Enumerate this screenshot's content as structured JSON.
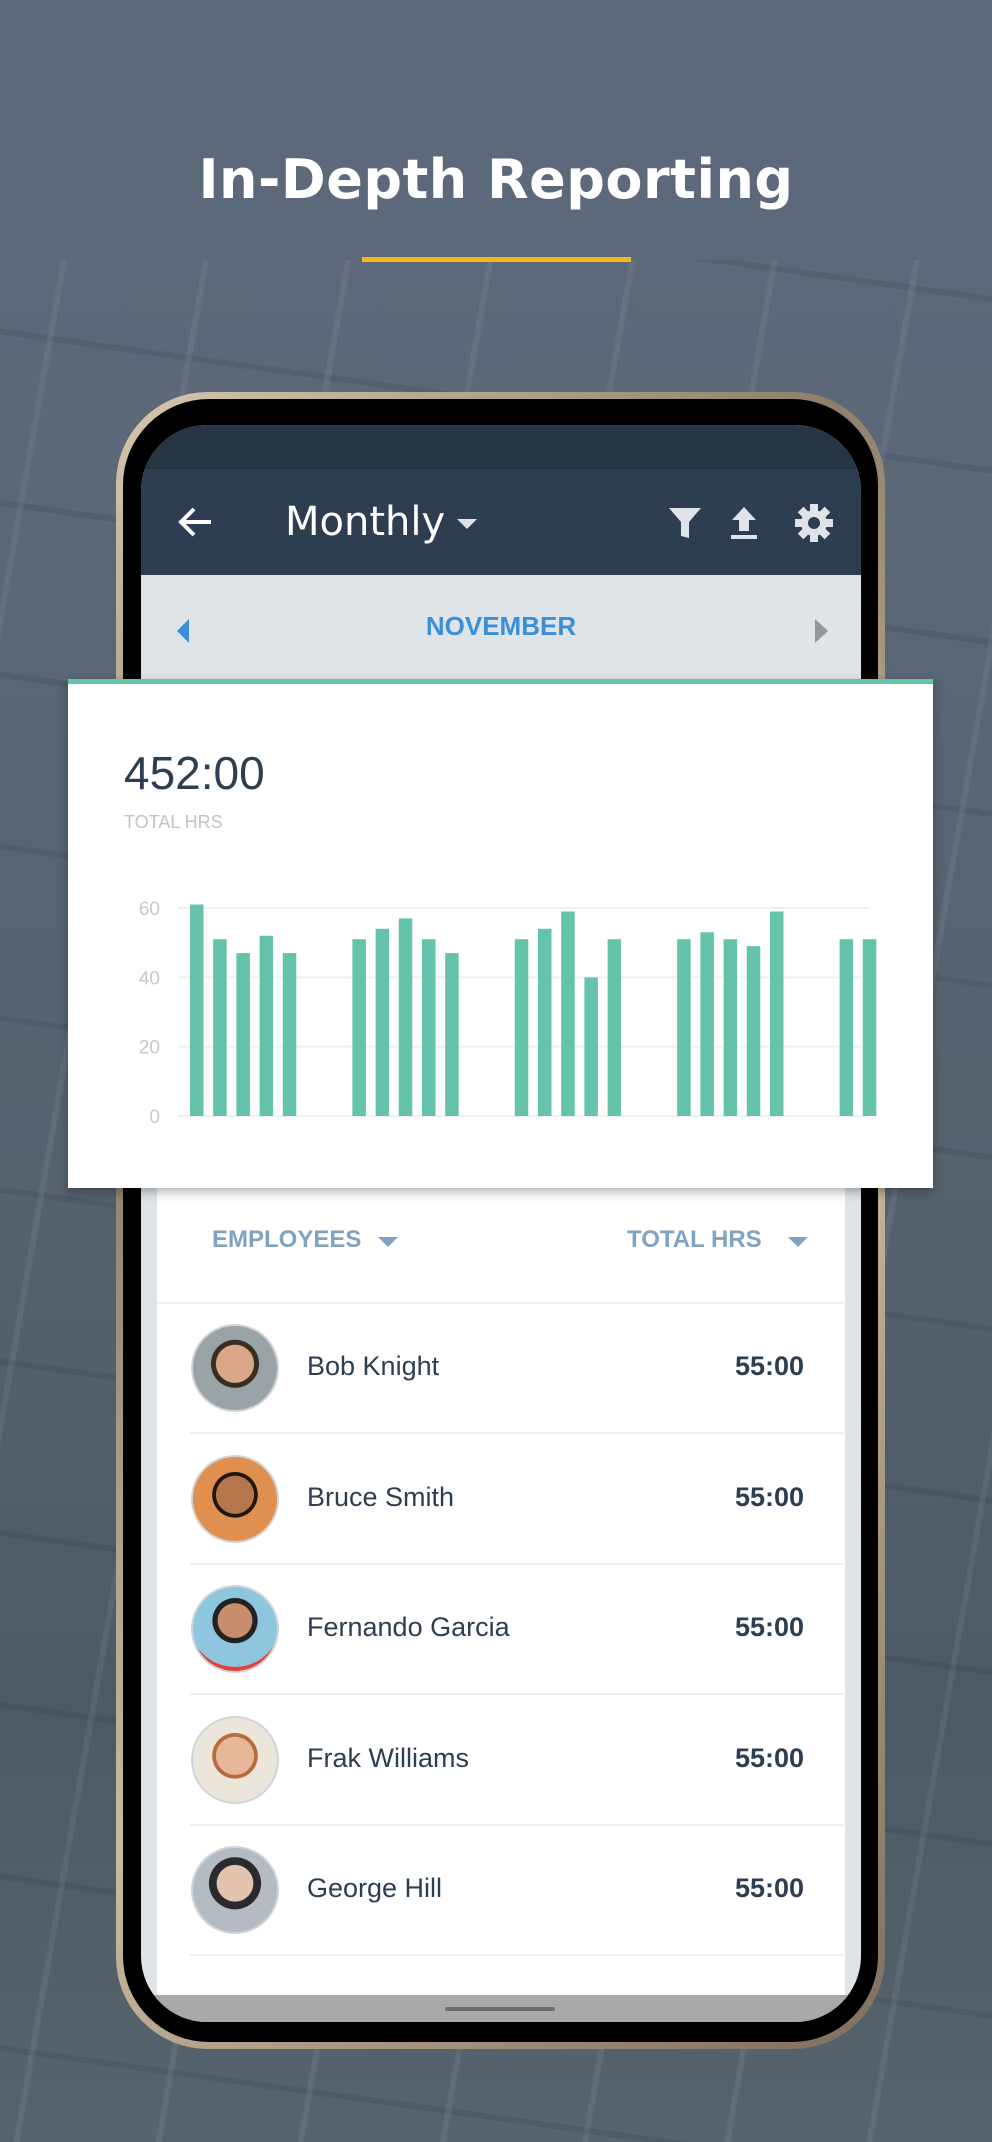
{
  "headline": "In-Depth Reporting",
  "colors": {
    "accent_yellow": "#f2b71a",
    "teal": "#66c3ab",
    "appbar": "#2d3e50",
    "month_blue": "#3a8fd6",
    "header_blue": "#7fa3c0"
  },
  "appbar": {
    "back_icon": "arrow-left-icon",
    "period": "Monthly",
    "icons": [
      "filter-icon",
      "export-icon",
      "gear-icon"
    ]
  },
  "month_nav": {
    "month": "NOVEMBER"
  },
  "summary": {
    "total": "452:00",
    "label": "TOTAL HRS"
  },
  "chart_data": {
    "type": "bar",
    "x": [
      1,
      2,
      3,
      4,
      5,
      8,
      9,
      10,
      11,
      12,
      15,
      16,
      17,
      18,
      19,
      22,
      23,
      24,
      25,
      26,
      29,
      30
    ],
    "values": [
      61,
      51,
      47,
      52,
      47,
      51,
      54,
      57,
      51,
      47,
      51,
      54,
      59,
      40,
      51,
      51,
      53,
      51,
      49,
      59,
      51,
      51
    ],
    "x_range": [
      1,
      30
    ],
    "ylim": [
      0,
      60
    ],
    "yticks": [
      "0",
      "20",
      "40",
      "60"
    ],
    "grid": true,
    "color": "#66c3ab"
  },
  "list": {
    "col_employees": "EMPLOYEES",
    "col_total": "TOTAL HRS",
    "rows": [
      {
        "name": "Bob Knight",
        "hours": "55:00"
      },
      {
        "name": "Bruce Smith",
        "hours": "55:00"
      },
      {
        "name": "Fernando Garcia",
        "hours": "55:00"
      },
      {
        "name": "Frak Williams",
        "hours": "55:00"
      },
      {
        "name": "George Hill",
        "hours": "55:00"
      }
    ]
  }
}
